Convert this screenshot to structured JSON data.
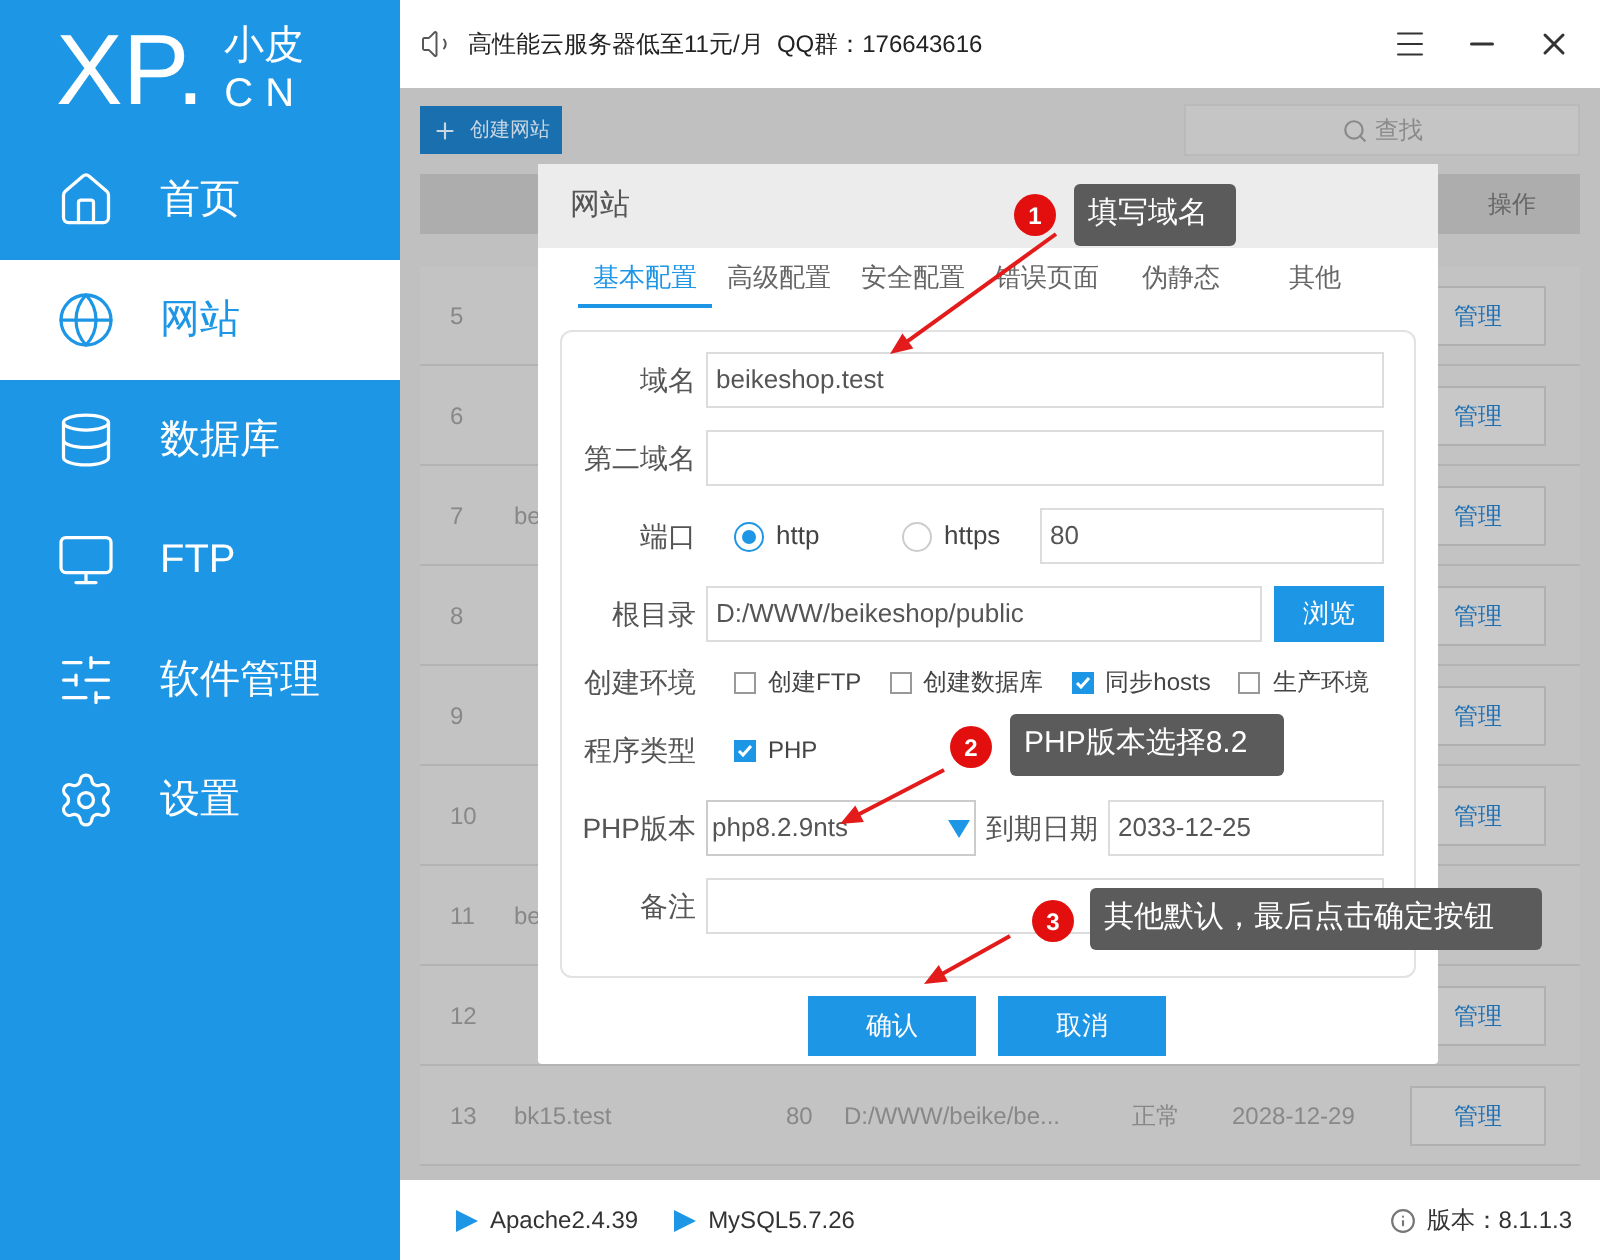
{
  "sidebar": {
    "logo": {
      "main": "XP.",
      "top": "小皮",
      "bottom": "CN"
    },
    "items": [
      {
        "label": "首页",
        "kind": "home",
        "selected": false
      },
      {
        "label": "网站",
        "kind": "globe",
        "selected": true
      },
      {
        "label": "数据库",
        "kind": "database",
        "selected": false
      },
      {
        "label": "FTP",
        "kind": "monitor",
        "selected": false
      },
      {
        "label": "软件管理",
        "kind": "sliders",
        "selected": false
      },
      {
        "label": "设置",
        "kind": "gear",
        "selected": false
      }
    ]
  },
  "top_bar": {
    "announcement": "高性能云服务器低至11元/月  QQ群：176643616"
  },
  "toolbar": {
    "create_button": "创建网站",
    "search_placeholder": "查找"
  },
  "table": {
    "action_header": "操作",
    "rows": [
      {
        "number": "5",
        "action": "管理"
      },
      {
        "number": "6",
        "action": "管理"
      },
      {
        "number": "7",
        "domain": "be",
        "action": "管理"
      },
      {
        "number": "8",
        "action": "管理"
      },
      {
        "number": "9",
        "action": "管理"
      },
      {
        "number": "10",
        "action": "管理"
      },
      {
        "number": "11",
        "domain": "be"
      },
      {
        "number": "12",
        "action": "管理"
      },
      {
        "number": "13",
        "domain": "bk15.test",
        "port": "80",
        "root": "D:/WWW/beike/be...",
        "status": "正常",
        "expires": "2028-12-29",
        "action": "管理"
      }
    ]
  },
  "dialog": {
    "title": "网站",
    "tabs": [
      {
        "label": "基本配置",
        "selected": true
      },
      {
        "label": "高级配置",
        "selected": false
      },
      {
        "label": "安全配置",
        "selected": false
      },
      {
        "label": "错误页面",
        "selected": false
      },
      {
        "label": "伪静态",
        "selected": false
      },
      {
        "label": "其他",
        "selected": false
      }
    ],
    "domain": {
      "label": "域名",
      "value": "beikeshop.test"
    },
    "second_domain": {
      "label": "第二域名"
    },
    "port": {
      "label": "端口",
      "options": [
        {
          "label": "http",
          "selected": true
        },
        {
          "label": "https",
          "selected": false
        }
      ],
      "value": "80"
    },
    "root": {
      "label": "根目录",
      "value": "D:/WWW/beikeshop/public",
      "button": "浏览"
    },
    "environment": {
      "label": "创建环境",
      "options": [
        {
          "label": "创建FTP",
          "checked": false
        },
        {
          "label": "创建数据库",
          "checked": false
        },
        {
          "label": "同步hosts",
          "checked": true
        },
        {
          "label": "生产环境",
          "checked": false
        }
      ]
    },
    "program_type": {
      "label": "程序类型",
      "options": [
        {
          "label": "PHP",
          "checked": true
        }
      ]
    },
    "php_version": {
      "label": "PHP版本",
      "value": "php8.2.9nts"
    },
    "expiry": {
      "label": "到期日期",
      "value": "2033-12-25"
    },
    "remark": {
      "label": "备注"
    },
    "buttons": [
      "确认",
      "取消"
    ]
  },
  "annotations": [
    {
      "number": "1",
      "text": "填写域名"
    },
    {
      "number": "2",
      "text": "PHP版本选择8.2"
    },
    {
      "number": "3",
      "text": "其他默认，最后点击确定按钮"
    }
  ],
  "status_bar": {
    "services": [
      "Apache2.4.39",
      "MySQL5.7.26"
    ],
    "version": "版本：8.1.1.3"
  }
}
